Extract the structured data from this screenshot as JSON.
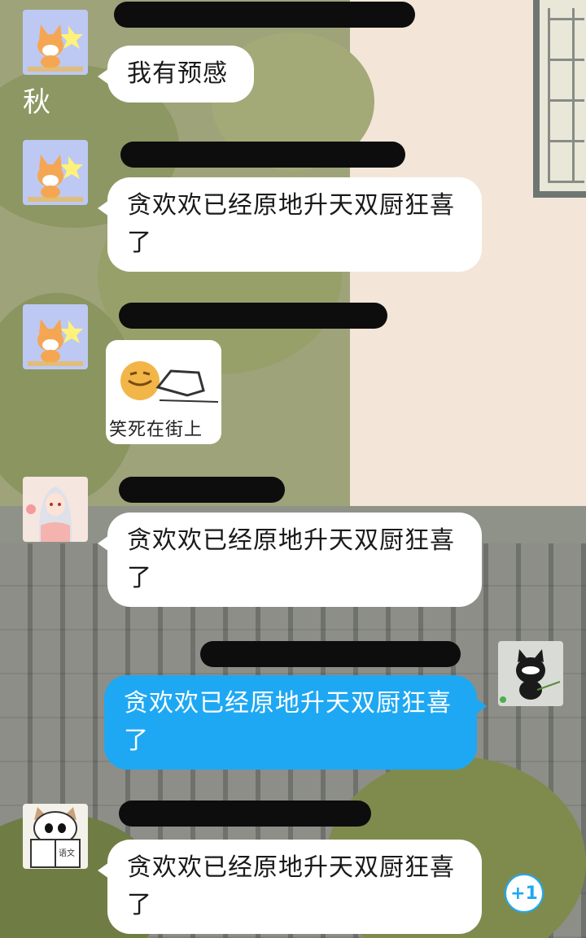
{
  "messages": [
    {
      "sender": "other",
      "avatar": "fox-avatar",
      "text": "我有预感",
      "tag": "秋"
    },
    {
      "sender": "other",
      "avatar": "fox-avatar",
      "text": "贪欢欢已经原地升天双厨狂喜了"
    },
    {
      "sender": "other",
      "avatar": "fox-avatar",
      "sticker": "笑死在街上"
    },
    {
      "sender": "other",
      "avatar": "anime-girl-avatar",
      "text": "贪欢欢已经原地升天双厨狂喜了"
    },
    {
      "sender": "self",
      "avatar": "black-cat-avatar",
      "text": "贪欢欢已经原地升天双厨狂喜了"
    },
    {
      "sender": "other",
      "avatar": "cat-reading-avatar",
      "text": "贪欢欢已经原地升天双厨狂喜了",
      "avatar_text": "语文"
    }
  ],
  "plus_badge": "+1",
  "colors": {
    "bubble_self": "#1ea8f3",
    "bubble_other": "#ffffff",
    "redaction": "#0d0d0d"
  }
}
